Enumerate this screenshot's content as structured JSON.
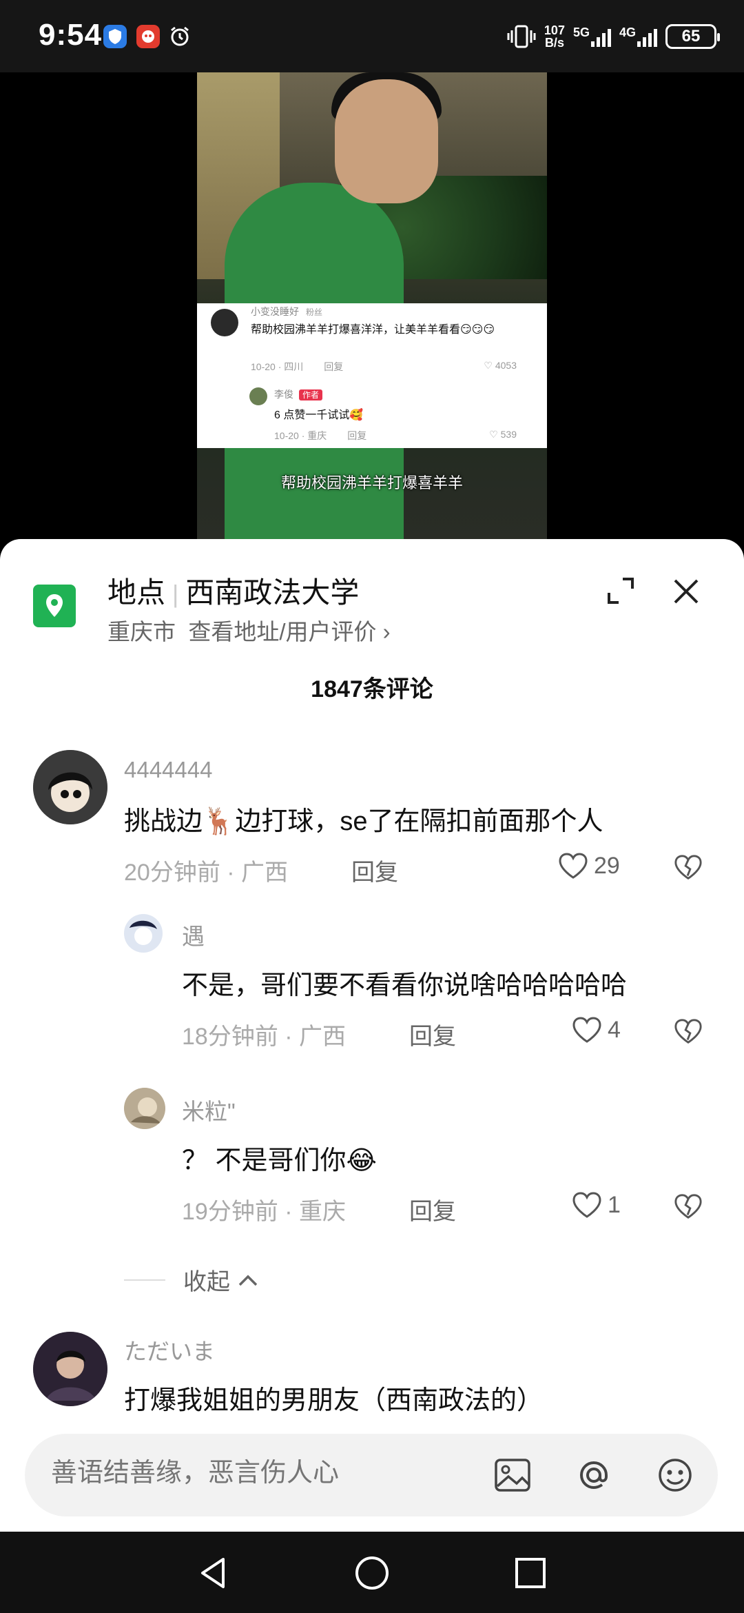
{
  "status_bar": {
    "time": "9:54",
    "net_speed": "107",
    "net_unit": "B/s",
    "signal1": "5G",
    "signal2": "4G",
    "battery": "65"
  },
  "video": {
    "card": {
      "user": "小变没睡好",
      "fan_badge": "粉丝",
      "text": "帮助校园沸羊羊打爆喜洋洋，让美羊羊看看😏😏😏",
      "meta": "10-20 · 四川",
      "reply": "回复",
      "likes": "4053",
      "reply_user": "李俊",
      "author_badge": "作者",
      "reply_text": "6 点赞一千试试🥰",
      "reply_meta": "10-20 · 重庆",
      "reply_reply": "回复",
      "reply_likes": "539"
    },
    "caption": "帮助校园沸羊羊打爆喜羊羊"
  },
  "location": {
    "label": "地点",
    "name": "西南政法大学",
    "city": "重庆市",
    "link": "查看地址/用户评价 ›"
  },
  "comment_count": "1847条评论",
  "comments": [
    {
      "user": "4444444",
      "text": "挑战边🦌边打球，se了在隔扣前面那个人",
      "time": "20分钟前 · 广西",
      "reply": "回复",
      "likes": "29"
    },
    {
      "user": "遇",
      "text": "不是，哥们要不看看你说啥哈哈哈哈哈",
      "time": "18分钟前 · 广西",
      "reply": "回复",
      "likes": "4"
    },
    {
      "user": "米粒\"",
      "text": "？ 不是哥们你😂",
      "time": "19分钟前 · 重庆",
      "reply": "回复",
      "likes": "1"
    },
    {
      "user": "ただいま",
      "text": "打爆我姐姐的男朋友（西南政法的）"
    }
  ],
  "collapse_label": "收起",
  "input": {
    "placeholder": "善语结善缘，恶言伤人心"
  },
  "colors": {
    "accent_green": "#20b254",
    "author_red": "#e8334d"
  }
}
